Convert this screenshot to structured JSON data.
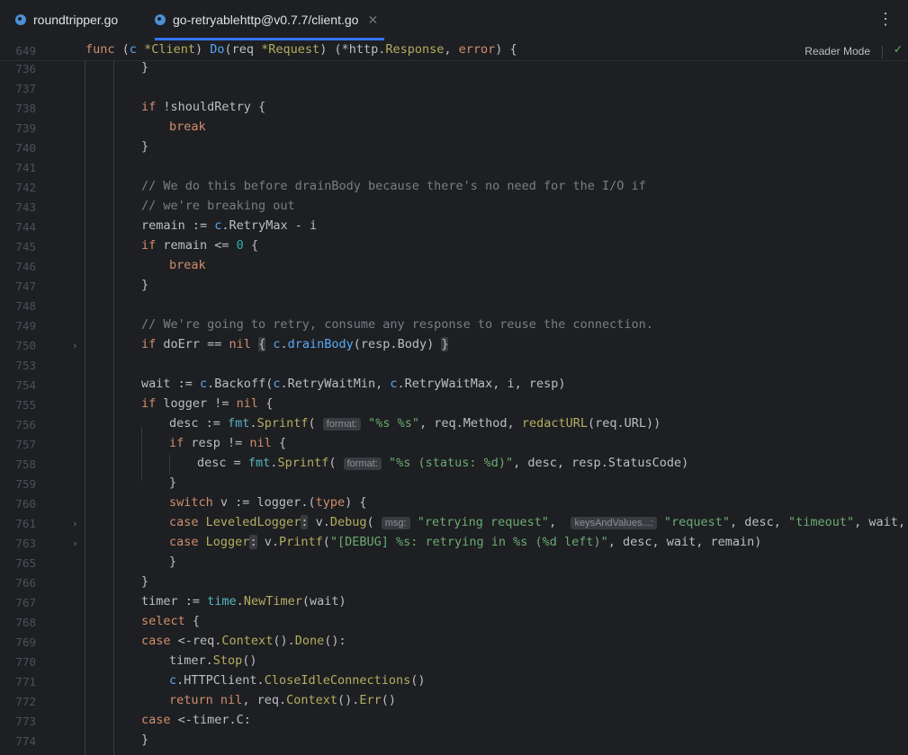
{
  "tabs": [
    {
      "label": "roundtripper.go",
      "active": false
    },
    {
      "label": "go-retryablehttp@v0.7.7/client.go",
      "active": true
    }
  ],
  "reader_mode": "Reader Mode",
  "sticky": {
    "line": "649"
  },
  "lines": [
    "736",
    "737",
    "738",
    "739",
    "740",
    "741",
    "742",
    "743",
    "744",
    "745",
    "746",
    "747",
    "748",
    "749",
    "750",
    "753",
    "754",
    "755",
    "756",
    "757",
    "758",
    "759",
    "760",
    "761",
    "763",
    "765",
    "766",
    "767",
    "768",
    "769",
    "770",
    "771",
    "772",
    "773",
    "774"
  ],
  "hints": {
    "format": "format:",
    "msg": "msg:",
    "kv": "keysAndValues...:"
  },
  "text": {
    "sticky_func": "func",
    "sticky_c": "c",
    "sticky_client": "*Client",
    "sticky_do": "Do",
    "sticky_req": "(req",
    "sticky_request": "*Request",
    "sticky_ret": ") (*http.",
    "sticky_response": "Response",
    "sticky_error": "error",
    "sticky_end": ") {"
  }
}
